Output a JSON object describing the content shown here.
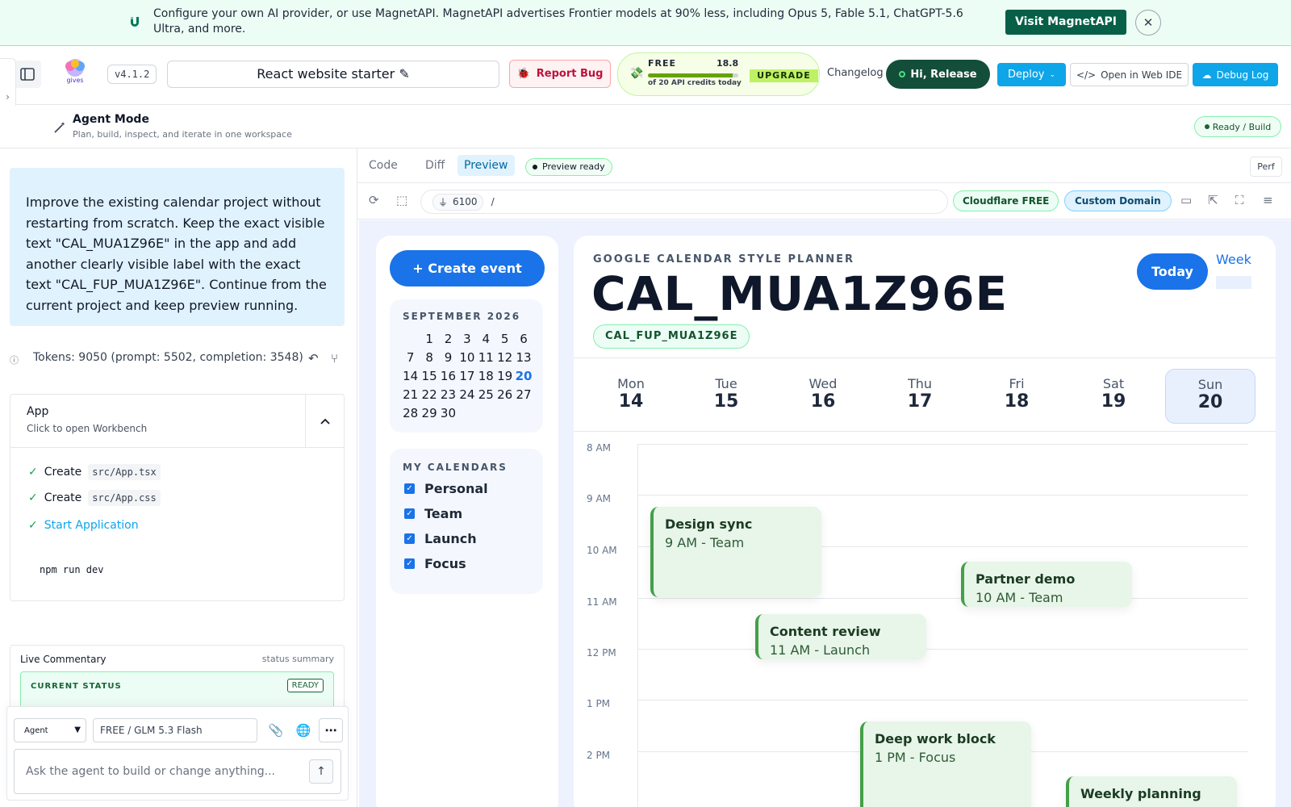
{
  "banner": {
    "text": "Configure your own AI provider, or use MagnetAPI. MagnetAPI advertises Frontier models at 90% less, including Opus 5, Fable 5.1, ChatGPT-5.6 Ultra, and more.",
    "cta": "Visit MagnetAPI",
    "close_icon": "close-icon"
  },
  "topbar": {
    "version": "v4.1.2",
    "project_name": "React website starter",
    "report_bug": "Report Bug",
    "credits": {
      "tier": "FREE",
      "remaining": "18.8",
      "subtitle": "of 20 API credits today",
      "fill": 0.94,
      "upgrade": "UPGRADE"
    },
    "changelog": "Changelog",
    "user": "Hi, Release",
    "deploy": "Deploy",
    "open_ide": "Open in Web IDE",
    "debug_log": "Debug Log"
  },
  "mode": {
    "title": "Agent Mode",
    "subtitle": "Plan, build, inspect, and iterate in one workspace",
    "status": "Ready / Build"
  },
  "chat": {
    "prompt": "Improve the existing calendar project without restarting from scratch. Keep the exact visible text \"CAL_MUA1Z96E\" in the app and add another clearly visible label with the exact text \"CAL_FUP_MUA1Z96E\". Continue from the current project and keep preview running.",
    "tokens": "Tokens: 9050 (prompt: 5502, completion: 3548)",
    "app_card": {
      "title": "App",
      "subtitle": "Click to open Workbench",
      "steps": [
        {
          "verb": "Create",
          "file": "src/App.tsx"
        },
        {
          "verb": "Create",
          "file": "src/App.css"
        }
      ],
      "start": "Start Application",
      "command": "npm run dev"
    },
    "live": {
      "title": "Live Commentary",
      "summary": "status summary",
      "current_status": "CURRENT STATUS",
      "badge": "READY"
    },
    "composer": {
      "mode": "Agent",
      "model": "FREE / GLM 5.3 Flash",
      "placeholder": "Ask the agent to build or change anything..."
    }
  },
  "preview": {
    "tabs": [
      "Code",
      "Diff",
      "Preview"
    ],
    "active_tab": "Preview",
    "status": "Preview ready",
    "perf": "Perf",
    "port": "6100",
    "path": "/",
    "cloudflare": "Cloudflare FREE",
    "custom_domain": "Custom Domain"
  },
  "calendar": {
    "create": "+ Create event",
    "month": "SEPTEMBER 2026",
    "mini_days": [
      "",
      "1",
      "2",
      "3",
      "4",
      "5",
      "6",
      "7",
      "8",
      "9",
      "10",
      "11",
      "12",
      "13",
      "14",
      "15",
      "16",
      "17",
      "18",
      "19",
      "20",
      "21",
      "22",
      "23",
      "24",
      "25",
      "26",
      "27",
      "28",
      "29",
      "30"
    ],
    "today_day": "20",
    "my_calendars_title": "MY CALENDARS",
    "calendars": [
      "Personal",
      "Team",
      "Launch",
      "Focus"
    ],
    "eyebrow": "GOOGLE CALENDAR STYLE PLANNER",
    "title": "CAL_MUA1Z96E",
    "followup_label": "CAL_FUP_MUA1Z96E",
    "today_btn": "Today",
    "week_btn": "Week",
    "days": [
      {
        "name": "Mon",
        "num": "14"
      },
      {
        "name": "Tue",
        "num": "15"
      },
      {
        "name": "Wed",
        "num": "16"
      },
      {
        "name": "Thu",
        "num": "17"
      },
      {
        "name": "Fri",
        "num": "18"
      },
      {
        "name": "Sat",
        "num": "19"
      },
      {
        "name": "Sun",
        "num": "20"
      }
    ],
    "hours": [
      "8 AM",
      "9 AM",
      "10 AM",
      "11 AM",
      "12 PM",
      "1 PM",
      "2 PM"
    ],
    "events": [
      {
        "title": "Design sync",
        "sub": "9 AM - Team"
      },
      {
        "title": "Partner demo",
        "sub": "10 AM - Team"
      },
      {
        "title": "Content review",
        "sub": "11 AM - Launch"
      },
      {
        "title": "Deep work block",
        "sub": "1 PM - Focus"
      },
      {
        "title": "Weekly planning",
        "sub": ""
      }
    ]
  }
}
